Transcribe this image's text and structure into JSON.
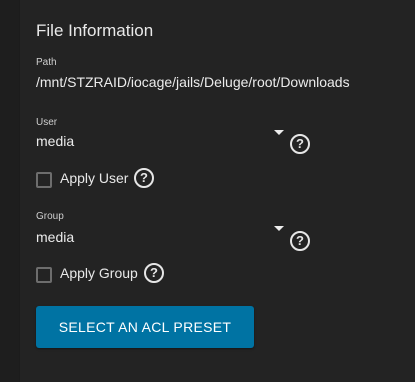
{
  "card": {
    "title": "File Information"
  },
  "path": {
    "label": "Path",
    "value": "/mnt/STZRAID/iocage/jails/Deluge/root/Downloads"
  },
  "user": {
    "label": "User",
    "value": "media",
    "help_glyph": "?",
    "apply_label": "Apply User",
    "apply_checked": false
  },
  "group": {
    "label": "Group",
    "value": "media",
    "help_glyph": "?",
    "apply_label": "Apply Group",
    "apply_checked": false
  },
  "actions": {
    "acl_preset_label": "SELECT AN ACL PRESET"
  },
  "icons": {
    "dropdown": "chevron-down-icon",
    "help": "help-circle-icon",
    "checkbox": "checkbox-unchecked-icon"
  },
  "colors": {
    "background": "#1e1e1e",
    "card": "#232323",
    "accent": "#0073a3",
    "text": "#ececec"
  }
}
